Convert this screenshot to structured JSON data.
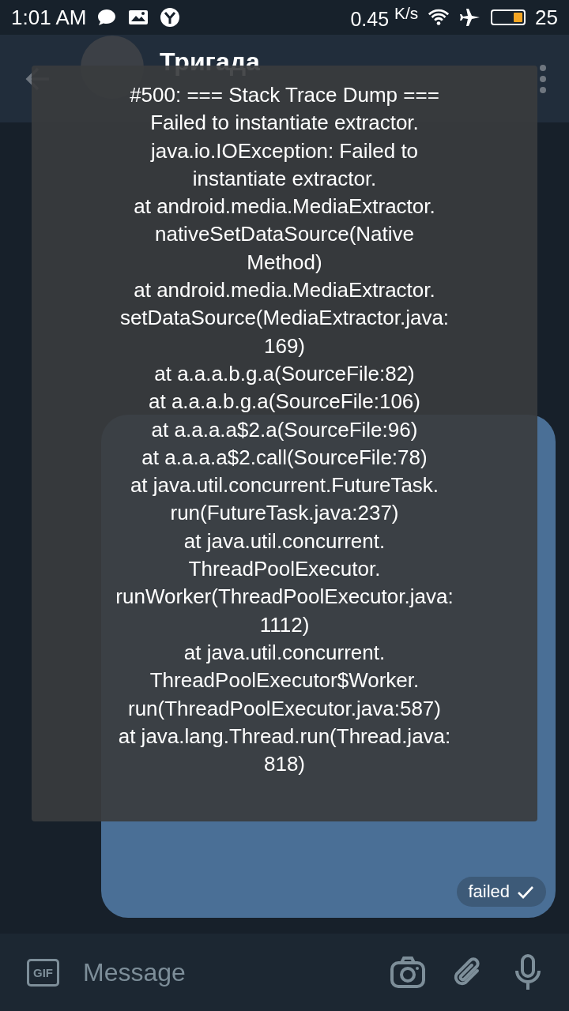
{
  "status_bar": {
    "time": "1:01 AM",
    "speed": "0.45 $^{K/s}$",
    "battery": {
      "level": 0.3,
      "text": "25"
    }
  },
  "header": {
    "title": "Тригада"
  },
  "outgoing_message": {
    "status": "failed"
  },
  "composer": {
    "gif_label": "GIF",
    "placeholder": "Message"
  },
  "toast": {
    "text": "#500: === Stack Trace Dump ===\nFailed to instantiate extractor.\njava.io.IOException: Failed to\ninstantiate extractor.\nat android.media.MediaExtractor.\nnativeSetDataSource(Native\nMethod)\nat android.media.MediaExtractor.\nsetDataSource(MediaExtractor.java:\n169)\nat a.a.a.b.g.a(SourceFile:82)\nat a.a.a.b.g.a(SourceFile:106)\nat a.a.a.a$2.a(SourceFile:96)\nat a.a.a.a$2.call(SourceFile:78)\nat java.util.concurrent.FutureTask.\nrun(FutureTask.java:237)\nat java.util.concurrent.\nThreadPoolExecutor.\nrunWorker(ThreadPoolExecutor.java:\n1112)\nat java.util.concurrent.\nThreadPoolExecutor$Worker.\nrun(ThreadPoolExecutor.java:587)\nat java.lang.Thread.run(Thread.java:\n818)"
  }
}
